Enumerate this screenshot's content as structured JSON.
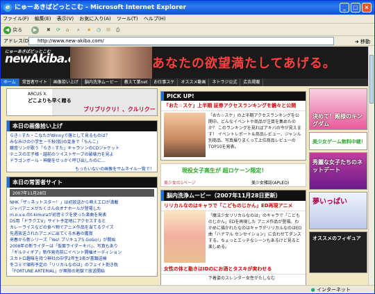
{
  "window": {
    "title": "にゅーあきばどっとこむ - Microsoft Internet Explorer"
  },
  "menu": [
    "ファイル(F)",
    "編集(E)",
    "表示(V)",
    "お気に入り(A)",
    "ツール(T)",
    "ヘルプ(H)"
  ],
  "toolbar": {
    "back": "戻る"
  },
  "address": {
    "label": "アドレス(D)",
    "url": "http://www.new-akiba.com/",
    "go": "移動"
  },
  "status": {
    "zone": "インターネット"
  },
  "site": {
    "logo": "newAkiba.com",
    "logo_small": "にゅーあきばどっとこむ",
    "slogan": "あなたの欲望満たしてあげる。",
    "nav": [
      "ホーム",
      "常習者サイト",
      "画像拾い上げ",
      "脳内洗浄ムービー",
      "教えて業net",
      "お仕事スケ",
      "オススメ動画",
      "ネトラジ公式",
      "広告掲載"
    ],
    "ad": {
      "line1": "ARCUS X.",
      "line2": "どこよりも早く贈る",
      "line3": "ブリブリクリ！、クルリクー"
    },
    "images": {
      "title": "本日の画像拾い上げ",
      "items": [
        "らき☆すた・こなたがWinnyで落として見るものは？",
        "みなみけの小学生・千秋(仮)の変身で「ちんこ」",
        "鏡音リンが歌う「らき☆すた」キャラソンのCDジャケット",
        "テニスの王子様・越前のツイストサーブの破壊力を見よ",
        "ドラゴンボール・神龍をせっかく呼び出したのに..."
      ],
      "more": "もったいないの画像をサムネイル一覧で！"
    },
    "jobs": {
      "title": "本日の常習者サイト",
      "date": "2007年11月28日",
      "items": [
        "NHK「ザ☆ネットスター！」は初放送から萌えエロが満載",
        "ジャパアニメがたくさんのオナホールが登場した",
        "m.o.v.e.のt-kimuraが初音ミクを使った楽曲を発表",
        "DS用「ドラクエV」サイト予定地にアクセスすると",
        "カレーライスなどの食べ物でアニメ作品を当てるクイズ",
        "先週放送されたアニメに出てくる水着の鑑賞",
        "来春から新シリーズ「Yes! プリキュア5 GoGo!」が開始",
        "2008年の新ライダーは「仮面ライダーキバ」、写真もあり",
        "「ギルティギア」新作発売前にイベント開催オーディション",
        "スカトロ趣味を持つ神社の中学2年生3名が書類送検",
        "冬コミで頒布予定の「リリカルなのは」のフェイト抱き枕",
        "「FORTUNE ARTERIAL」が無限の地獄で放送開始"
      ]
    },
    "pickup": {
      "title": "PICK UP!",
      "headline": "「おた☆スケ」上半期 証券アクセスランキングを鏡々と公開",
      "body": "「おた☆スケ」の上半期アクセスランキングを公開中。どんなイベントや商品が注目を集めたのか？ このランキングを見ればアキバの今が見えます！ イベントレポート＆商品レビュー、ジャンル別商品、写真撮りまくって上位商品レビューのTOP10を発表。",
      "ad": "現役女子高生が 超ロケーン限定！",
      "ad_sub": "美少女の1ページ",
      "ad_tag": "美少女雑誌(APLEO)"
    },
    "movie": {
      "title": "脳内洗浄ムービー（2007年11月28日更新）",
      "headline": "リリカルなのはキャラで「こどものじかん」ED再現アニメ",
      "body": "「魔法少女リリカルなのは」のキャラで「こどものじかん」EDを再現した アニメ作品が登場。わかめに描かれたなのはキャラがリリカルなのはED曲「ハナマル センセイション」に合わせてダンスする。ちょっとエッチなシーンもあるけど見ると楽しめる。",
      "headline2": "女性の体と動きはIDのにお酒とタスキが実わせる",
      "body2": "下着姿のスレンダー女性がたしなむ"
    },
    "right_ads": [
      "決めて！殿様のキングダム",
      "美少女ゲーム無料中継！",
      "秀麗な女子たちのネットデート",
      "夢いっぱい",
      "オススメのフィギュア"
    ]
  }
}
